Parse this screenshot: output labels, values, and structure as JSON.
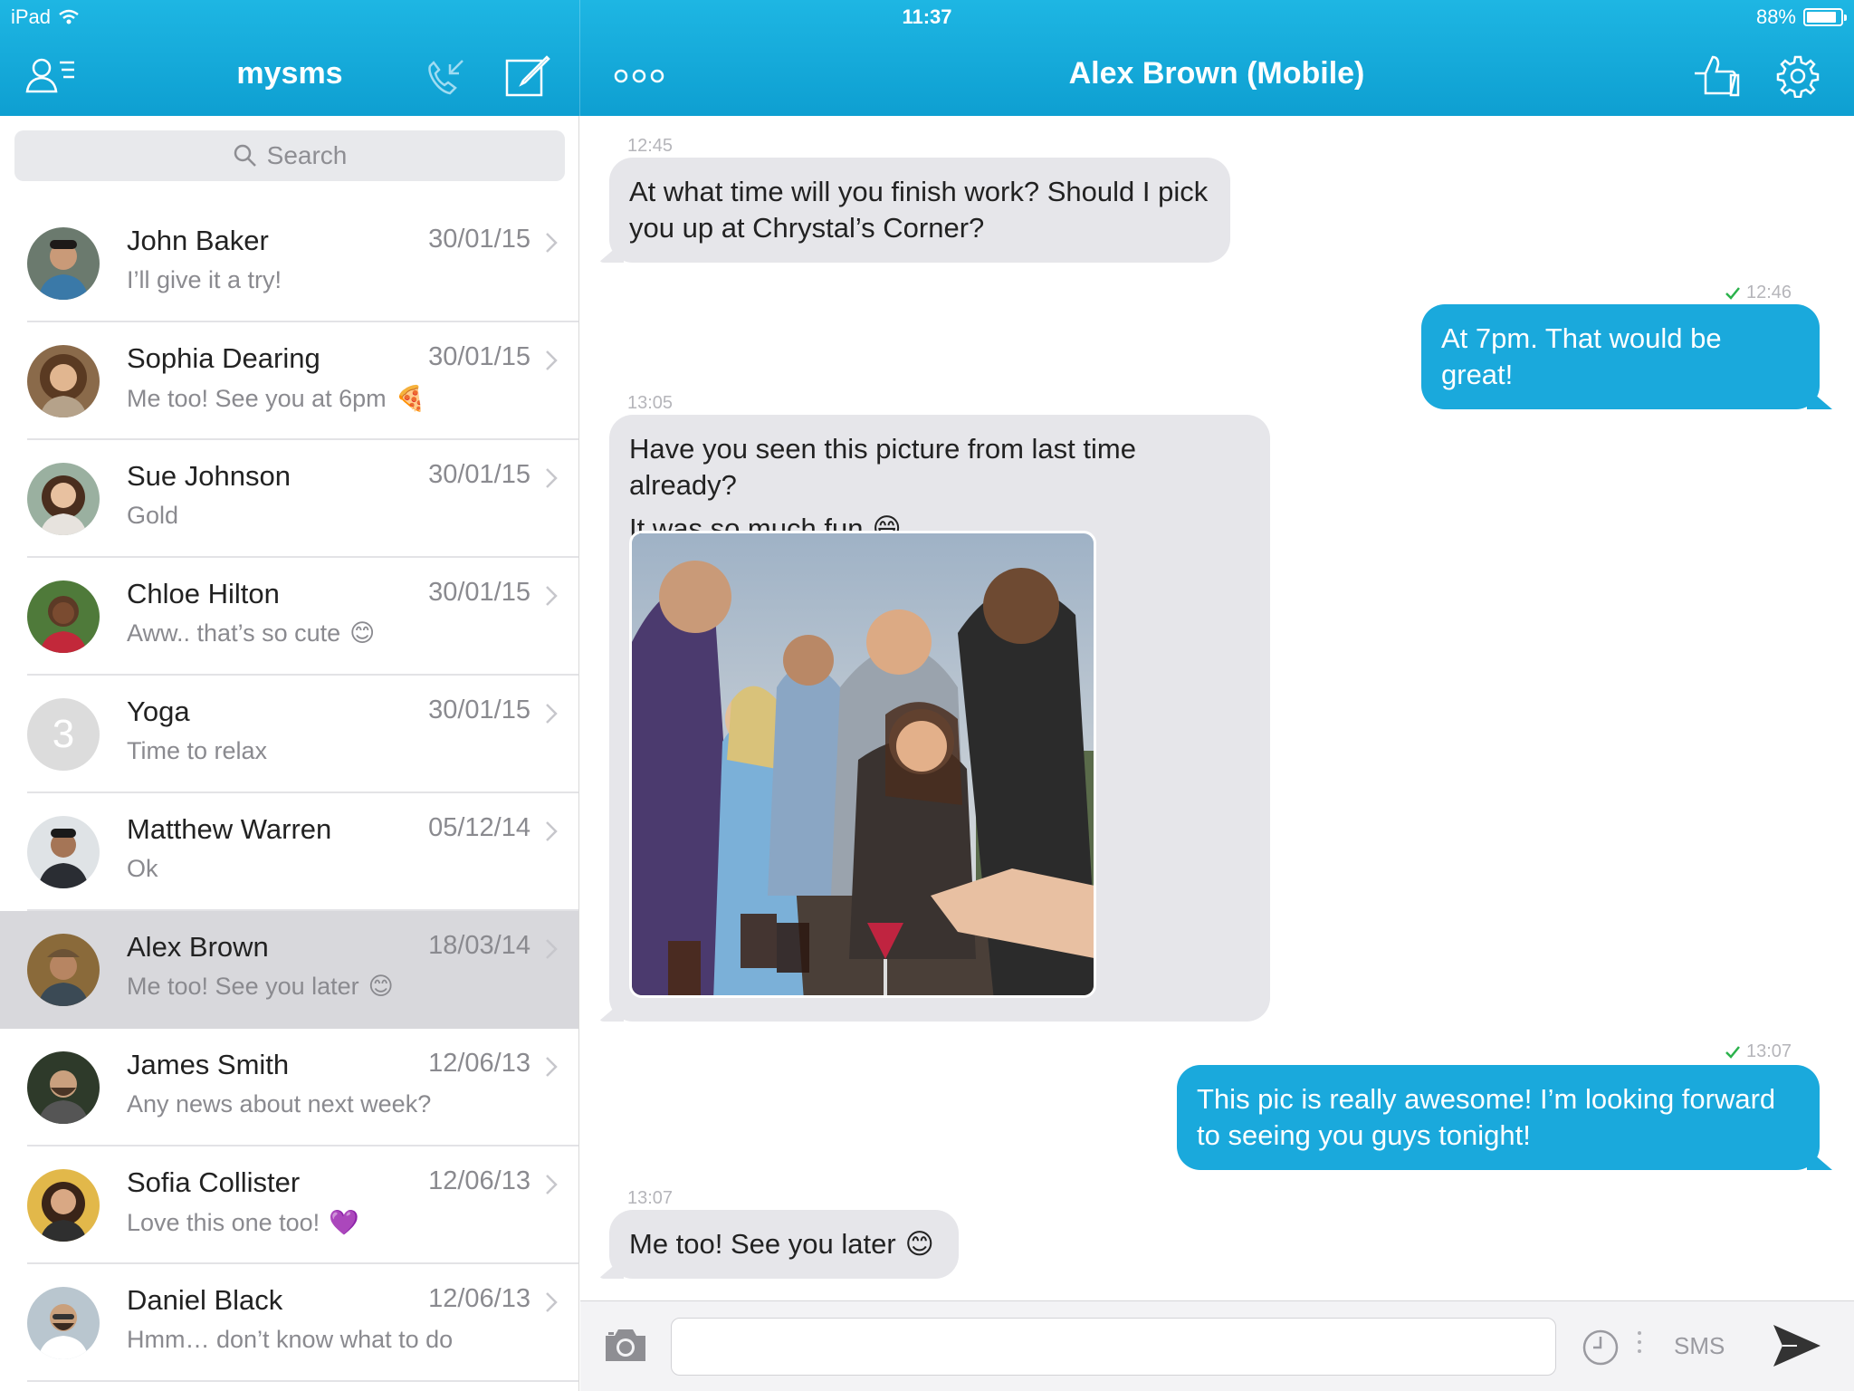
{
  "status_bar": {
    "device": "iPad",
    "time": "11:37",
    "battery": "88%",
    "battery_level": 0.88
  },
  "sidebar": {
    "title": "mysms",
    "search_placeholder": "Search",
    "conversations": [
      {
        "name": "John Baker",
        "date": "30/01/15",
        "preview": "I’ll give it a try!",
        "emoji": ""
      },
      {
        "name": "Sophia Dearing",
        "date": "30/01/15",
        "preview": "Me too! See you at 6pm",
        "emoji": "🍕"
      },
      {
        "name": "Sue Johnson",
        "date": "30/01/15",
        "preview": "Gold",
        "emoji": ""
      },
      {
        "name": "Chloe Hilton",
        "date": "30/01/15",
        "preview": "Aww.. that’s so cute",
        "emoji": "😊"
      },
      {
        "name": "Yoga",
        "date": "30/01/15",
        "preview": "Time to relax",
        "emoji": "",
        "group_count": "3"
      },
      {
        "name": "Matthew Warren",
        "date": "05/12/14",
        "preview": "Ok",
        "emoji": ""
      },
      {
        "name": "Alex Brown",
        "date": "18/03/14",
        "preview": "Me too! See you later",
        "emoji": "😊"
      },
      {
        "name": "James Smith",
        "date": "12/06/13",
        "preview": "Any news about next week?",
        "emoji": ""
      },
      {
        "name": "Sofia Collister",
        "date": "12/06/13",
        "preview": "Love this one too!",
        "emoji": "💜"
      },
      {
        "name": "Daniel Black",
        "date": "12/06/13",
        "preview": "Hmm… don’t know what to do",
        "emoji": ""
      }
    ]
  },
  "conversation": {
    "title": "Alex Brown (Mobile)",
    "messages": [
      {
        "time": "12:45",
        "text": "At what time will you finish work? Should I pick you up at Chrystal’s Corner?"
      },
      {
        "time": "12:46",
        "text": "At 7pm. That would be great!"
      },
      {
        "time": "13:05",
        "text_line1": "Have you seen this picture from last time already?",
        "text_line2": "It was so much fun",
        "emoji": "😄"
      },
      {
        "time": "13:07",
        "text": "This pic is really awesome! I’m looking forward to seeing you guys tonight!"
      },
      {
        "time": "13:07",
        "text": "Me too! See you later",
        "emoji": "😊"
      }
    ]
  },
  "composer": {
    "input_value": "",
    "channel": "SMS"
  },
  "colors": {
    "accent": "#1aa9dc",
    "header_top": "#1eb6e3",
    "incoming_bubble": "#e6e6ea",
    "selected_row": "#d8d8dc"
  },
  "icons": [
    "wifi-icon",
    "battery-icon",
    "contacts-icon",
    "call-log-icon",
    "compose-icon",
    "more-icon",
    "like-icon",
    "settings-icon",
    "search-icon",
    "chevron-right-icon",
    "camera-icon",
    "clock-icon",
    "send-icon",
    "checkmark-icon"
  ]
}
